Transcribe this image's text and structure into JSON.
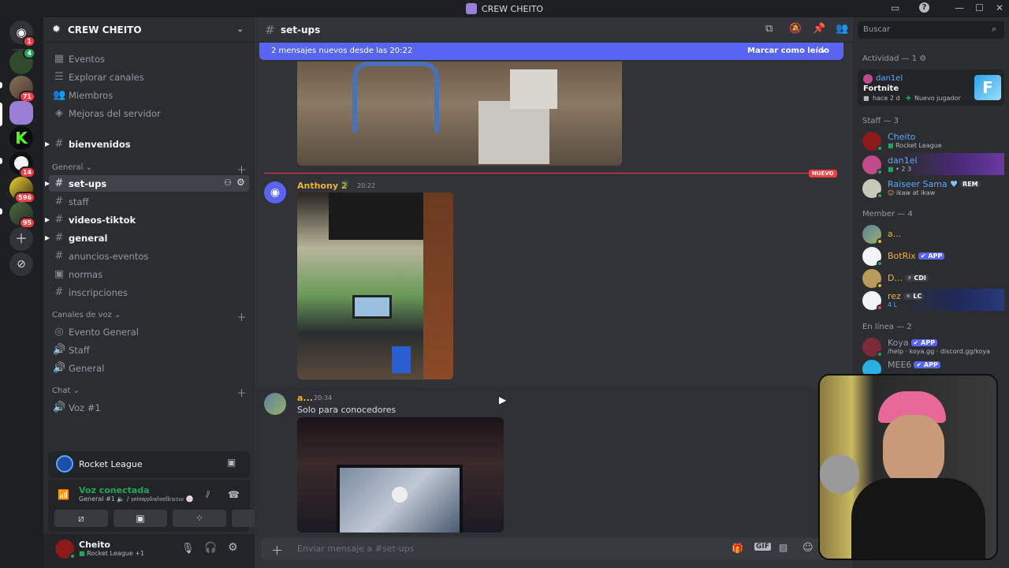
{
  "window": {
    "title": "CREW CHEITO"
  },
  "colors": {
    "accent": "#5865f2",
    "online": "#23a55a",
    "new_marker": "#f23f43",
    "name_yellow": "#f0b232",
    "name_blue": "#5aa8ff"
  },
  "servers": [
    {
      "icon": "discord-home-icon",
      "badge": "1"
    },
    {
      "icon": "server-icon",
      "badge": ""
    },
    {
      "icon": "server-icon",
      "badge": "71"
    },
    {
      "icon": "ghost-server-icon",
      "badge": ""
    },
    {
      "icon": "kick-server-icon",
      "badge": ""
    },
    {
      "icon": "server-icon",
      "badge": "14"
    },
    {
      "icon": "server-icon",
      "badge": "596"
    },
    {
      "icon": "server-icon",
      "badge": "95"
    }
  ],
  "guild": {
    "name": "CREW CHEITO",
    "nav": [
      {
        "icon": "calendar-icon",
        "label": "Eventos"
      },
      {
        "icon": "explore-icon",
        "label": "Explorar canales"
      },
      {
        "icon": "members-icon",
        "label": "Miembros"
      },
      {
        "icon": "boost-icon",
        "label": "Mejoras del servidor"
      }
    ],
    "top_channels": [
      {
        "label": "bienvenidos"
      }
    ],
    "categories": {
      "general": "General",
      "voice": "Canales de voz",
      "chat": "Chat"
    },
    "general_channels": [
      {
        "label": "set-ups",
        "state": "selected"
      },
      {
        "label": "staff",
        "state": "muted"
      },
      {
        "label": "videos-tiktok",
        "state": "unread"
      },
      {
        "label": "general",
        "state": "unread"
      },
      {
        "label": "anuncios-eventos",
        "state": "muted"
      },
      {
        "label": "normas",
        "state": "muted"
      },
      {
        "label": "inscripciones",
        "state": "muted"
      }
    ],
    "voice_channels": [
      {
        "label": "Evento General",
        "icon": "stage-icon"
      },
      {
        "label": "Staff",
        "icon": "speaker-icon"
      },
      {
        "label": "General",
        "icon": "speaker-icon"
      }
    ],
    "chat_channels": [
      {
        "label": "Voz #1",
        "icon": "speaker-icon"
      }
    ]
  },
  "activity_panel": {
    "game": "Rocket League"
  },
  "voice_panel": {
    "status": "Voz conectada",
    "channel": "General #1 🔈 / 𝔭𝔞𝔦𝔫𝔞𝔭𝔭𝔩𝔢𝔰/𝔪𝔬𝔩𝔩𝔢𝔶𝔠𝔯𝔲𝔢 🍥"
  },
  "user_panel": {
    "name": "Cheito",
    "status": "Rocket League +1"
  },
  "channel_header": {
    "name": "set-ups"
  },
  "banner": {
    "text": "2 mensajes nuevos desde las 20:22",
    "action": "Marcar como leído"
  },
  "new_divider": "NUEVO",
  "messages": [
    {
      "author": "Anthony 2",
      "time": "20:22",
      "text": ""
    },
    {
      "author": "a...",
      "time": "20:34",
      "text": "Solo para conocedores"
    }
  ],
  "input": {
    "placeholder": "Enviar mensaje a #set-ups"
  },
  "search": {
    "placeholder": "Buscar"
  },
  "members": {
    "activity_header": "Actividad — 1",
    "activity_card": {
      "user": "dan1el",
      "game": "Fortnite",
      "time": "hace 2 d",
      "note": "Nuevo jugador"
    },
    "staff_header": "Staff — 3",
    "staff": [
      {
        "name": "Cheito",
        "sub": "Rocket League",
        "color": "#5aa8ff",
        "tag": ""
      },
      {
        "name": "dan1el",
        "sub": "• 2 3",
        "color": "#5aa8ff",
        "tag": ""
      },
      {
        "name": "Raiseer Sama",
        "sub": "ikaw at ikaw",
        "color": "#5aa8ff",
        "tag": "REM"
      }
    ],
    "member_header": "Member — 4",
    "member_list": [
      {
        "name": "a...",
        "sub": "",
        "color": "#f0b232",
        "tag": ""
      },
      {
        "name": "BotRix",
        "sub": "",
        "color": "#f0b232",
        "tag": "APP"
      },
      {
        "name": "D...",
        "sub": "",
        "color": "#f0b232",
        "tag": "CDI"
      },
      {
        "name": "rez",
        "sub": "4 L",
        "color": "#f0b232",
        "tag": "LC"
      }
    ],
    "online_header": "En línea — 2",
    "online": [
      {
        "name": "Koya",
        "sub": "/help · koya.gg · discord.gg/koya",
        "color": "#949ba4",
        "tag": "APP"
      },
      {
        "name": "MEE6",
        "sub": "",
        "color": "#949ba4",
        "tag": "APP"
      }
    ]
  }
}
